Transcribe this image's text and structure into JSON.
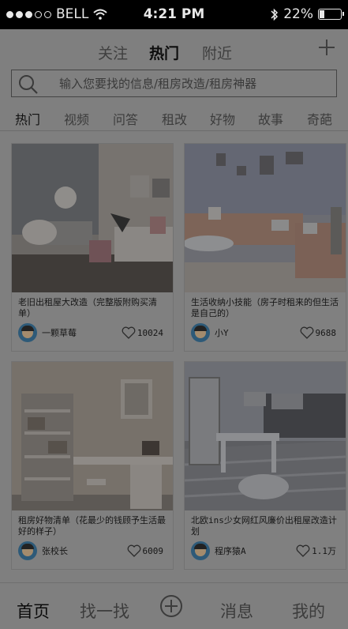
{
  "status_bar": {
    "carrier": "BELL",
    "time": "4:21 PM",
    "battery": "22%",
    "battery_level": 0.22,
    "icons": [
      "signal-dots-icon",
      "wifi-icon",
      "bluetooth-icon",
      "battery-icon"
    ]
  },
  "top_tabs": [
    {
      "label": "关注",
      "active": false
    },
    {
      "label": "热门",
      "active": true
    },
    {
      "label": "附近",
      "active": false
    }
  ],
  "add_icon": "plus-icon",
  "search": {
    "placeholder": "输入您要找的信息/租房改造/租房神器",
    "icon": "search-icon"
  },
  "categories": [
    {
      "label": "热门",
      "active": true
    },
    {
      "label": "视频",
      "active": false
    },
    {
      "label": "问答",
      "active": false
    },
    {
      "label": "租改",
      "active": false
    },
    {
      "label": "好物",
      "active": false
    },
    {
      "label": "故事",
      "active": false
    },
    {
      "label": "奇葩",
      "active": false
    }
  ],
  "posts": [
    {
      "title": "老旧出租屋大改造（完整版附购买清单）",
      "author": "一颗草莓",
      "likes": "10024"
    },
    {
      "title": "生活收纳小技能（房子时租来的但生活是自己的）",
      "author": "小Y",
      "likes": "9688"
    },
    {
      "title": "租房好物清单（花最少的钱顾予生活最好的样子）",
      "author": "张校长",
      "likes": "6009"
    },
    {
      "title": "北欧ins少女网红风廉价出租屋改造计划",
      "author": "程序猿A",
      "likes": "1.1万"
    }
  ],
  "bottom_nav": [
    {
      "label": "首页",
      "active": true
    },
    {
      "label": "找一找",
      "active": false
    },
    {
      "label": "消息",
      "active": false
    },
    {
      "label": "我的",
      "active": false
    }
  ],
  "bottom_add_icon": "circle-plus-icon",
  "colors": {
    "overlay_gray": "#7f7f7f",
    "status_bar_bg": "#000000",
    "avatar_bg": "#2e5a78"
  }
}
